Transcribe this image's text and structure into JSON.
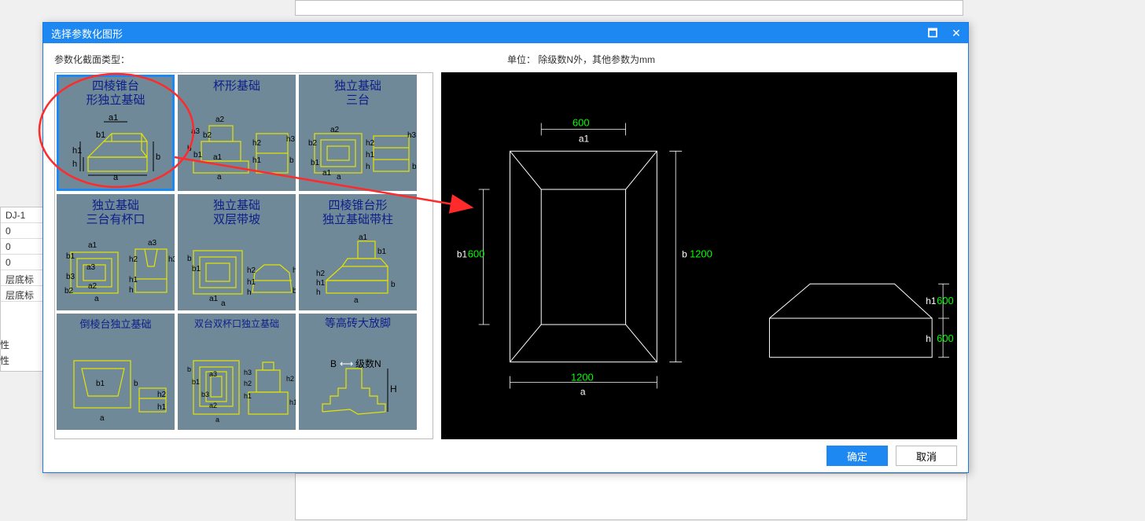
{
  "dialog": {
    "title": "选择参数化图形",
    "window_controls": {
      "max": "🗖",
      "close": "✕"
    },
    "labels": {
      "section_type": "参数化截面类型：",
      "unit_note": "单位：  除级数N外，其他参数为mm"
    },
    "thumbnails": [
      {
        "title_line1": "四棱锥台",
        "title_line2": "形独立基础",
        "selected": true
      },
      {
        "title_line1": "杯形基础",
        "title_line2": ""
      },
      {
        "title_line1": "独立基础",
        "title_line2": "三台"
      },
      {
        "title_line1": "独立基础",
        "title_line2": "三台有杯口"
      },
      {
        "title_line1": "独立基础",
        "title_line2": "双层带坡"
      },
      {
        "title_line1": "四棱锥台形",
        "title_line2": "独立基础带柱"
      },
      {
        "title_line1": "倒棱台独立基础",
        "title_line2": ""
      },
      {
        "title_line1": "双台双杯口独立基础",
        "title_line2": ""
      },
      {
        "title_line1": "等高砖大放脚",
        "title_line2": ""
      }
    ],
    "preview_values": {
      "a1_top": "600",
      "a1_label": "a1",
      "b1_left": "600",
      "b1_label": "b1",
      "b_right": "1200",
      "b_label": "b",
      "a_bottom": "1200",
      "a_label": "a",
      "h1_right": "600",
      "h1_label": "h1",
      "h_right": "600",
      "h_label": "h"
    },
    "buttons": {
      "ok": "确定",
      "cancel": "取消"
    }
  },
  "background": {
    "rows": [
      "DJ-1",
      "0",
      "0",
      "0",
      "层底标",
      "层底标"
    ],
    "attr_labels": [
      "性",
      "性"
    ]
  }
}
